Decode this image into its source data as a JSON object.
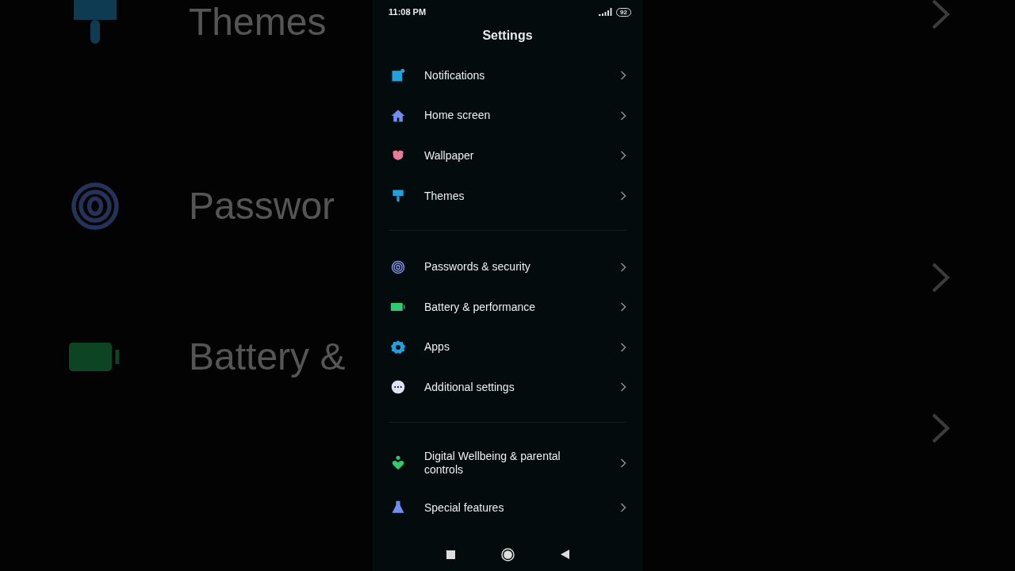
{
  "backdrop": {
    "labels": [
      {
        "label": "Themes"
      },
      {
        "label": "Passwor"
      },
      {
        "label": "Battery &"
      }
    ]
  },
  "status_bar": {
    "time": "11:08 PM",
    "battery": "92"
  },
  "title": "Settings",
  "groups": [
    {
      "items": [
        {
          "label": "Notifications"
        },
        {
          "label": "Home screen"
        },
        {
          "label": "Wallpaper"
        },
        {
          "label": "Themes"
        }
      ]
    },
    {
      "items": [
        {
          "label": "Passwords & security"
        },
        {
          "label": "Battery & performance"
        },
        {
          "label": "Apps"
        },
        {
          "label": "Additional settings"
        }
      ]
    },
    {
      "items": [
        {
          "label": "Digital Wellbeing & parental controls"
        },
        {
          "label": "Special features"
        }
      ]
    }
  ]
}
